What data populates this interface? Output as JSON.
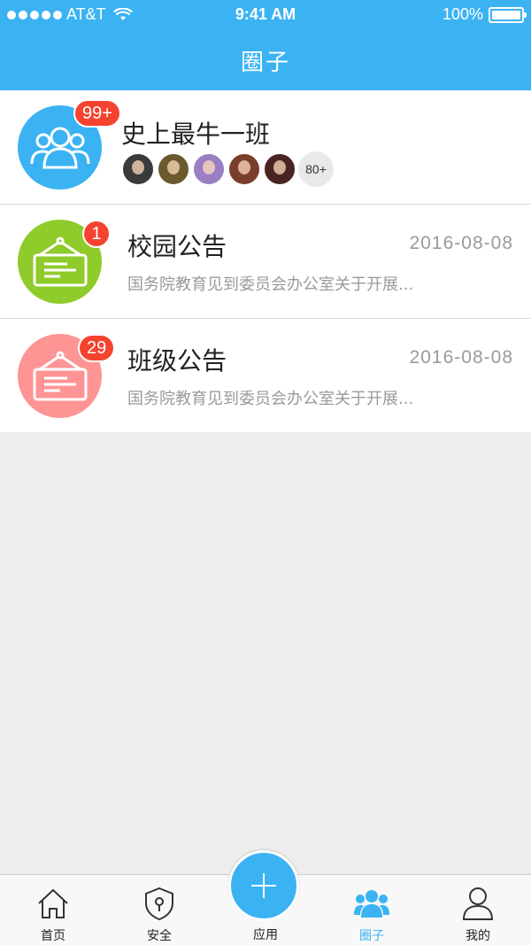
{
  "status_bar": {
    "carrier": "AT&T",
    "time": "9:41 AM",
    "battery": "100%"
  },
  "header": {
    "title": "圈子"
  },
  "rows": [
    {
      "title": "史上最牛一班",
      "badge": "99+",
      "icon": "group-icon",
      "color": "#3bb3f3",
      "member_count": "80+"
    },
    {
      "title": "校园公告",
      "badge": "1",
      "icon": "notice-board-icon",
      "color": "#8fcb2b",
      "date": "2016-08-08",
      "subtitle": "国务院教育见到委员会办公室关于开展..."
    },
    {
      "title": "班级公告",
      "badge": "29",
      "icon": "notice-board-icon",
      "color": "#ff9494",
      "date": "2016-08-08",
      "subtitle": "国务院教育见到委员会办公室关于开展..."
    }
  ],
  "tabbar": {
    "home": "首页",
    "security": "安全",
    "apps": "应用",
    "circle": "圈子",
    "mine": "我的"
  },
  "colors": {
    "accent": "#3bb3f3",
    "badge": "#f4432f"
  }
}
